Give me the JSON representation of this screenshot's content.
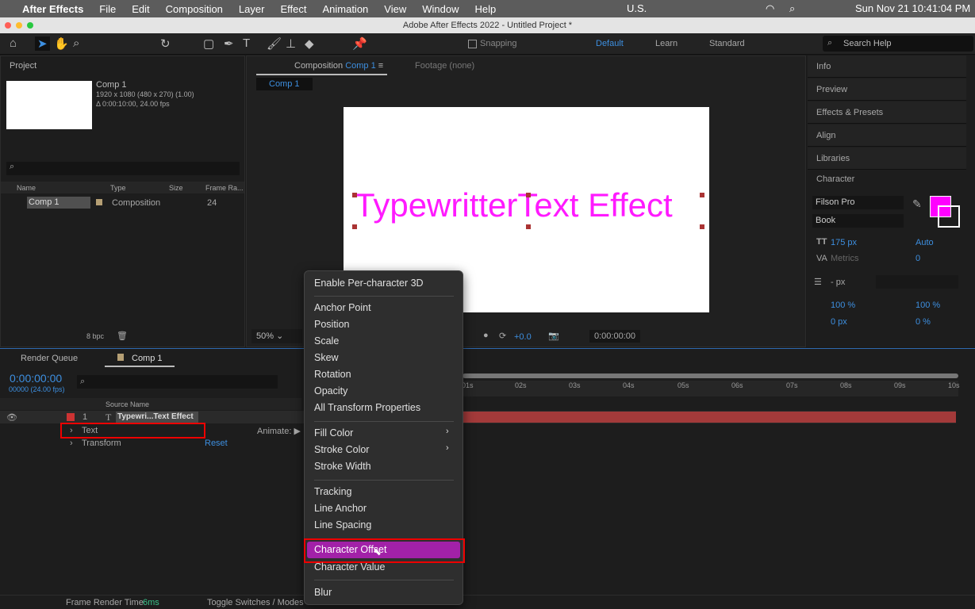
{
  "menubar": {
    "app": "After Effects",
    "items": [
      "File",
      "Edit",
      "Composition",
      "Layer",
      "Effect",
      "Animation",
      "View",
      "Window",
      "Help"
    ],
    "input_source": "U.S.",
    "clock": "Sun Nov 21  10:41:04 PM"
  },
  "window": {
    "title": "Adobe After Effects 2022 - Untitled Project *"
  },
  "toolbar": {
    "snapping": "Snapping",
    "workspaces": [
      "Default",
      "Learn",
      "Standard"
    ],
    "search_help": "Search Help"
  },
  "project": {
    "title": "Project",
    "comp_name": "Comp 1",
    "comp_info1": "1920 x 1080  (480 x 270) (1.00)",
    "comp_info2": "Δ 0:00:10:00, 24.00 fps",
    "columns": [
      "Name",
      "Type",
      "Size",
      "Frame Ra..."
    ],
    "row": {
      "name": "Comp 1",
      "type": "Composition",
      "fps": "24"
    },
    "bpc": "8 bpc"
  },
  "viewer": {
    "tab_prefix": "Composition",
    "tab_comp": "Comp 1",
    "footage_tab": "Footage (none)",
    "crumb": "Comp 1",
    "canvas_text": "TypewritterText Effect",
    "zoom": "50%",
    "exposure": "+0.0",
    "timecode": "0:00:00:00",
    "text_color": "#ff1aff"
  },
  "right_panels": [
    "Info",
    "Preview",
    "Effects & Presets",
    "Align",
    "Libraries"
  ],
  "character": {
    "title": "Character",
    "font": "Filson Pro",
    "style": "Book",
    "size": "175 px",
    "leading": "Auto",
    "kerning": "Metrics",
    "tracking": "0",
    "stroke": "- px",
    "vscale": "100 %",
    "hscale": "100 %",
    "baseline": "0 px",
    "tsume": "0 %",
    "fill_color": "#ff00ff"
  },
  "timeline": {
    "render_queue": "Render Queue",
    "comp_tab": "Comp 1",
    "timecode": "0:00:00:00",
    "frames": "00000 (24.00 fps)",
    "source_col": "Source Name",
    "layer_num": "1",
    "layer_name": "Typewri...Text Effect",
    "prop_text": "Text",
    "prop_transform": "Transform",
    "animate": "Animate:",
    "reset": "Reset",
    "ruler": [
      "01s",
      "02s",
      "03s",
      "04s",
      "05s",
      "06s",
      "07s",
      "08s",
      "09s",
      "10s"
    ],
    "frame_render_label": "Frame Render Time",
    "frame_render_value": "6ms",
    "toggle": "Toggle Switches / Modes"
  },
  "context_menu": {
    "groups": [
      [
        "Enable Per-character 3D"
      ],
      [
        "Anchor Point",
        "Position",
        "Scale",
        "Skew",
        "Rotation",
        "Opacity",
        "All Transform Properties"
      ],
      [
        "Fill Color",
        "Stroke Color",
        "Stroke Width"
      ],
      [
        "Tracking",
        "Line Anchor",
        "Line Spacing"
      ],
      [
        "Character Offset",
        "Character Value"
      ],
      [
        "Blur"
      ]
    ],
    "highlighted": "Character Offset"
  }
}
